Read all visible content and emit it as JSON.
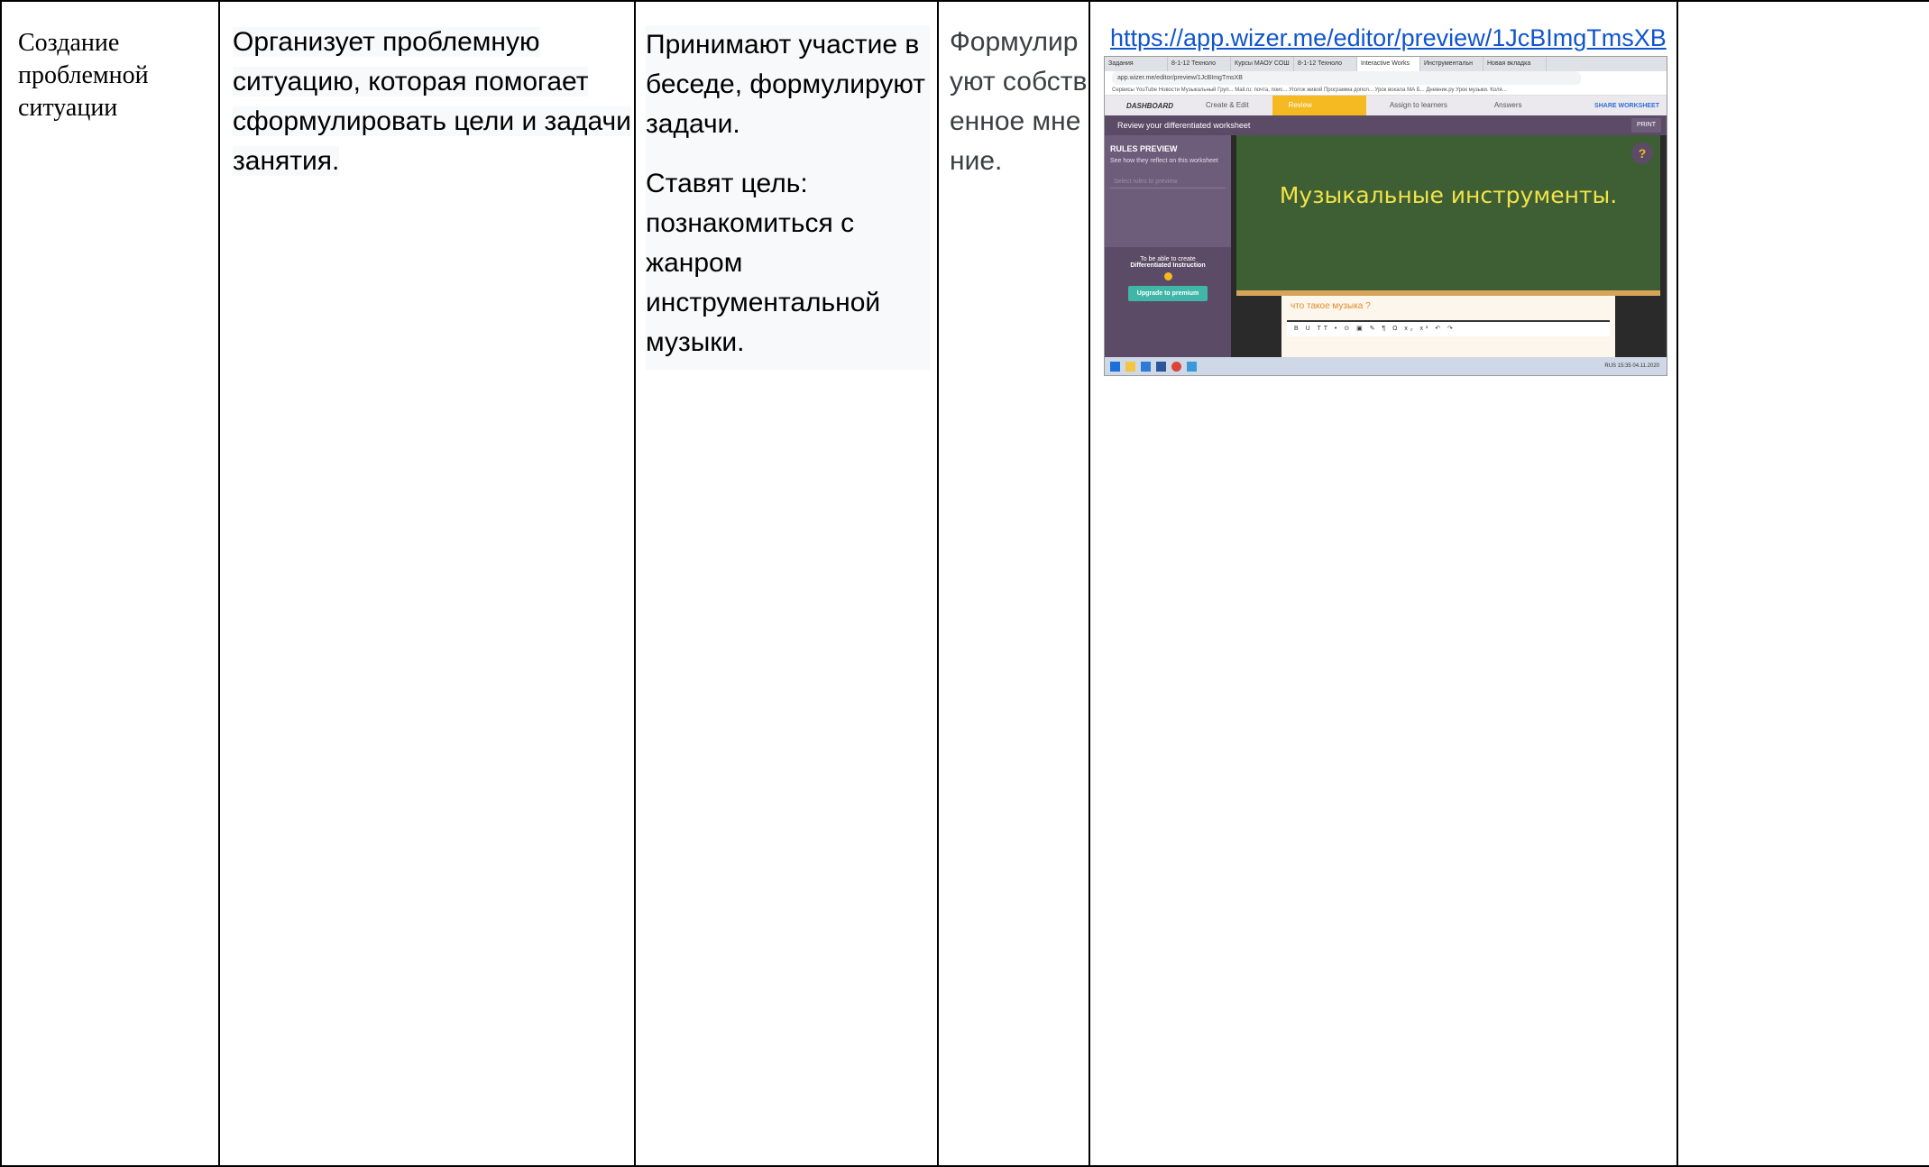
{
  "table": {
    "stage": "Создание проблемной ситуации",
    "teacher_activity": "Организует проблемную ситуацию, которая помогает сформулировать цели и задачи занятия.",
    "student_activity_1": "Принимают участие в беседе, формулируют задачи.",
    "student_activity_2": "Ставят цель: познакомиться с жанром инструментальной музыки.",
    "result": "Формулируют собственное мнение.",
    "resource_link": "https://app.wizer.me/editor/preview/1JcBImgTmsXB"
  },
  "screenshot": {
    "tabs": [
      "Задания",
      "8-1-12 Техноло",
      "Курсы МАОУ СОШ",
      "8-1-12 Техноло",
      "Interactive Works",
      "Инструментальн",
      "Новая вкладка"
    ],
    "address": "app.wizer.me/editor/preview/1JcBImgTmsXB",
    "bookmarks": "Сервисы  YouTube  Новости  Музыкальный Груп...  Mail.ru: почта, поис...  Уголок живой  Программа допол...  Урок вокала МА Б...  Дневник.ру  Урок музыки. Коля...",
    "nav": {
      "dashboard": "DASHBOARD",
      "create": "Create & Edit",
      "review": "Review",
      "assign": "Assign to learners",
      "answers": "Answers",
      "share": "SHARE WORKSHEET"
    },
    "title": "Review your differentiated worksheet",
    "print": "PRINT",
    "rules_preview": "RULES PREVIEW",
    "rules_sub": "See how they reflect on this worksheet",
    "select_rules": "Select rules to preview",
    "upgrade_text": "To be able to create",
    "upgrade_bold": "Differentiated Instruction",
    "upgrade_button": "Upgrade to premium",
    "board_text": "Музыкальные инструменты.",
    "help": "?",
    "card_title": "что такое музыка ?",
    "toolbar": "B U TT • ⊙ ▣ ✎ ¶ Ω x₂ x² ↶ ↷",
    "tray": "RUS  15:35  04.11.2020"
  }
}
